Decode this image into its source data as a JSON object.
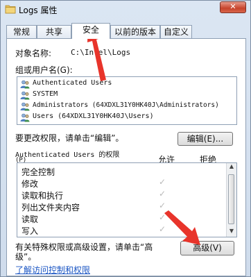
{
  "window": {
    "title": "Logs 属性",
    "close_label": "✕"
  },
  "tabs": [
    {
      "label": "常规"
    },
    {
      "label": "共享"
    },
    {
      "label": "安全"
    },
    {
      "label": "以前的版本"
    },
    {
      "label": "自定义"
    }
  ],
  "security": {
    "object_label": "对象名称:",
    "object_value": "C:\\Intel\\Logs",
    "group_label": "组或用户名(G):",
    "users": [
      {
        "name": "Authenticated Users",
        "icon": "users-icon"
      },
      {
        "name": "SYSTEM",
        "icon": "users-icon"
      },
      {
        "name": "Administrators (64XDXL31Y0HK40J\\Administrators)",
        "icon": "users-icon"
      },
      {
        "name": "Users (64XDXL31Y0HK40J\\Users)",
        "icon": "users-icon"
      }
    ],
    "change_hint": "要更改权限，请单击“编辑”。",
    "edit_button": "编辑(E)...",
    "permissions_title": "Authenticated Users 的权限",
    "permissions_key": "(P)",
    "allow_header": "允许",
    "deny_header": "拒绝",
    "permissions": [
      {
        "name": "完全控制",
        "allow": false,
        "deny": false
      },
      {
        "name": "修改",
        "allow": true,
        "deny": false
      },
      {
        "name": "读取和执行",
        "allow": true,
        "deny": false
      },
      {
        "name": "列出文件夹内容",
        "allow": true,
        "deny": false
      },
      {
        "name": "读取",
        "allow": true,
        "deny": false
      },
      {
        "name": "写入",
        "allow": true,
        "deny": false
      }
    ],
    "check_mark": "✓",
    "special_hint_line1": "有关特殊权限或高级设置，请单击“高",
    "special_hint_line2": "级”。",
    "advanced_button": "高级(V)",
    "learn_link": "了解访问控制和权限"
  },
  "annotation": {
    "arrow_color": "#e8342b"
  }
}
